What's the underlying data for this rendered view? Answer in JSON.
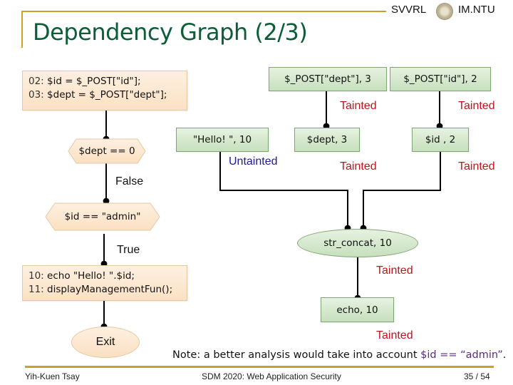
{
  "header": {
    "title": "Dependency Graph (2/3)",
    "brand_left": "SVVRL",
    "brand_right": "IM.NTU",
    "accent_color": "#c9a227",
    "title_color": "#0b5e36"
  },
  "flowchart": {
    "code_block_1": {
      "lines": [
        {
          "num": "02:",
          "code": "$id = $_POST[\"id\"];"
        },
        {
          "num": "03:",
          "code": "$dept = $_POST[\"dept\"];"
        }
      ]
    },
    "decision_1": "$dept == 0",
    "decision_1_branch": "False",
    "decision_2": "$id == \"admin\"",
    "decision_2_branch": "True",
    "code_block_2": {
      "lines": [
        {
          "num": "10:",
          "code": "echo \"Hello! \".$id;"
        },
        {
          "num": "11:",
          "code": "displayManagementFun();"
        }
      ]
    },
    "exit": "Exit"
  },
  "dependency_graph": {
    "nodes": {
      "post_dept": "$_POST[\"dept\"], 3",
      "post_id": "$_POST[\"id\"], 2",
      "hello": "\"Hello! \", 10",
      "dept": "$dept, 3",
      "id": "$id , 2",
      "str_concat": "str_concat, 10",
      "echo": "echo, 10"
    },
    "labels": {
      "post_dept_edge": "Tainted",
      "post_id_edge": "Tainted",
      "hello_edge": "Untainted",
      "dept_edge": "Tainted",
      "id_edge": "Tainted",
      "concat_edge": "Tainted",
      "echo_edge": "Tainted"
    },
    "colors": {
      "tainted": "#c0141c",
      "untainted": "#1c1c96"
    }
  },
  "note": {
    "prefix": "Note: a better analysis would take into account ",
    "highlight": "$id == “admin”",
    "suffix": "."
  },
  "footer": {
    "author": "Yih-Kuen Tsay",
    "course": "SDM 2020: Web Application Security",
    "page": "35 / 54"
  }
}
